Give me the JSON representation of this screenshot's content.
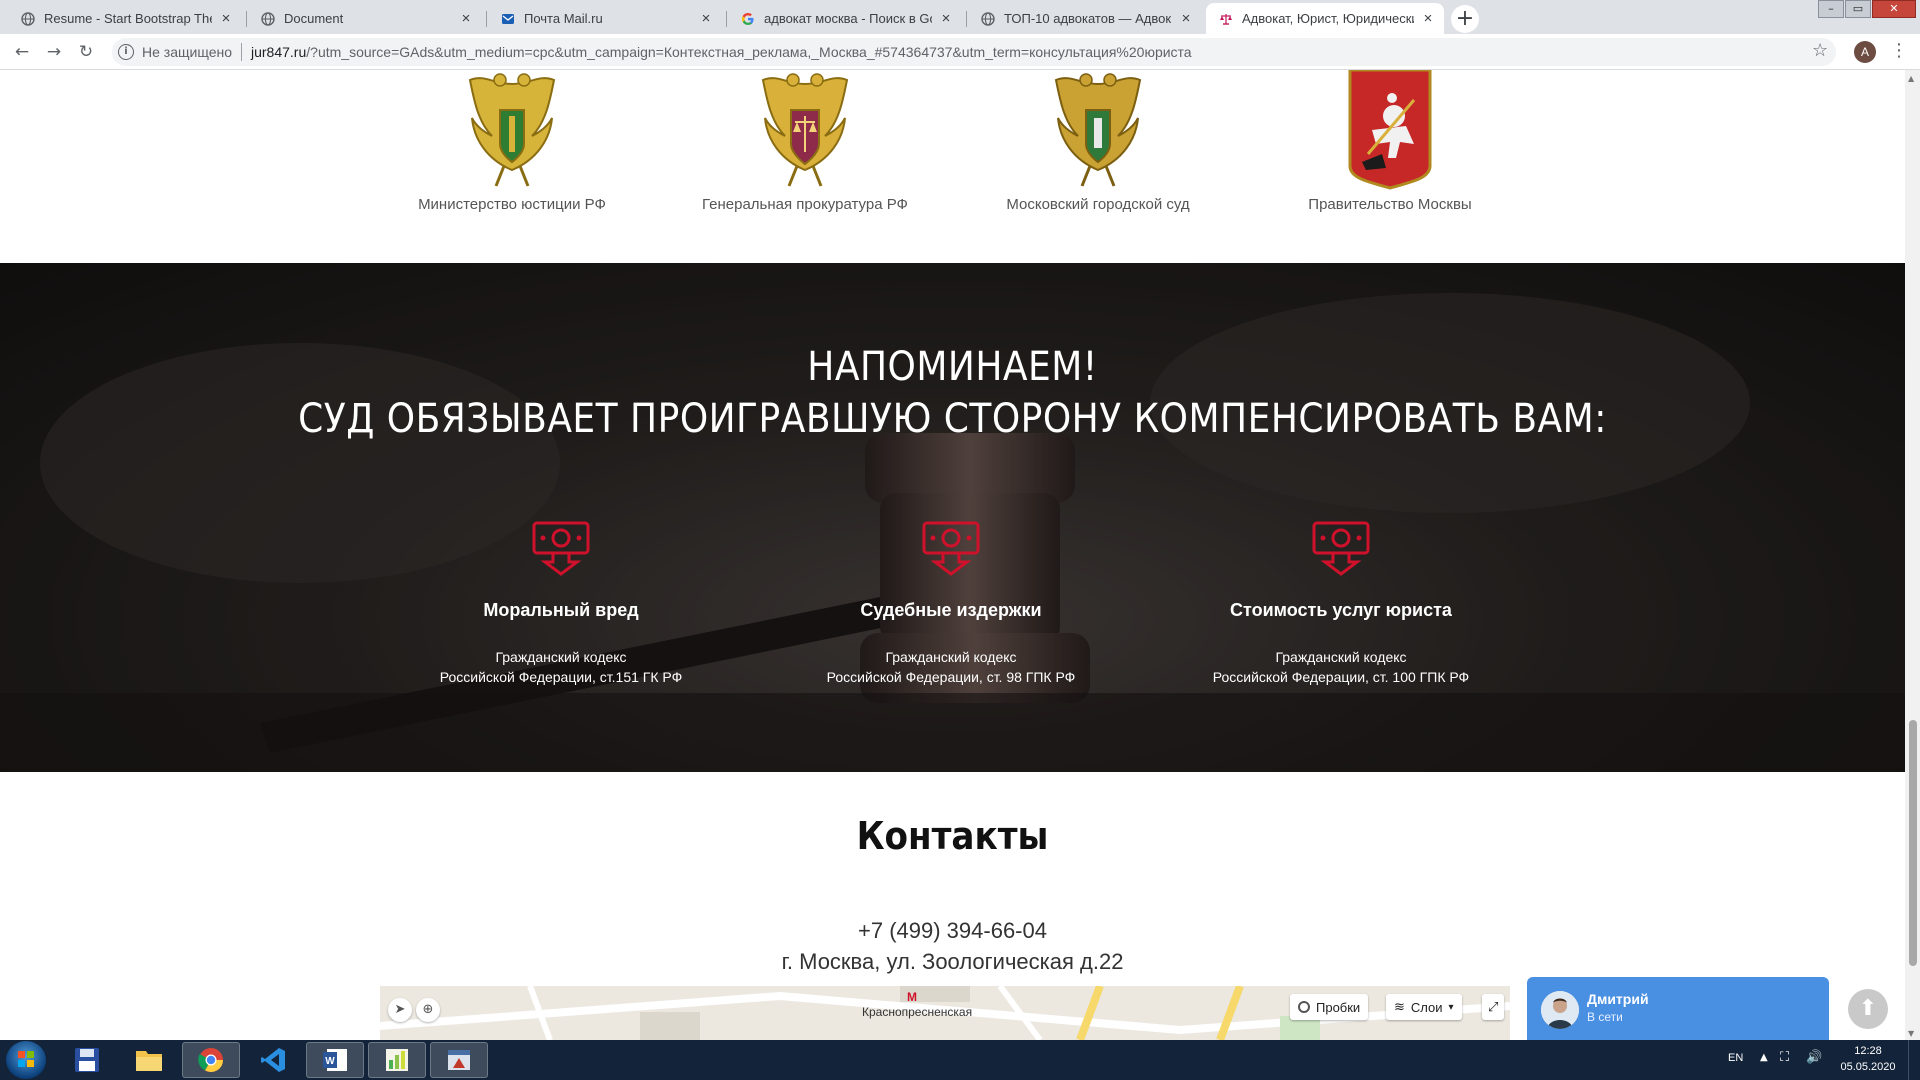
{
  "browser": {
    "tabs": [
      {
        "title": "Resume - Start Bootstrap Theme",
        "icon": "globe-icon",
        "active": false
      },
      {
        "title": "Document",
        "icon": "globe-icon",
        "active": false
      },
      {
        "title": "Почта Mail.ru",
        "icon": "mail-icon",
        "active": false
      },
      {
        "title": "адвокат москва - Поиск в Goog",
        "icon": "google-icon",
        "active": false
      },
      {
        "title": "ТОП-10 адвокатов — Адвокат К",
        "icon": "globe-icon",
        "active": false
      },
      {
        "title": "Адвокат, Юрист, Юридические",
        "icon": "scales-icon",
        "active": true
      }
    ],
    "security_label": "Не защищено",
    "url_host": "jur847.ru",
    "url_rest": "/?utm_source=GAds&utm_medium=cpc&utm_campaign=Контекстная_реклама,_Москва_#574364737&utm_term=консультация%20юриста",
    "profile_initial": "A"
  },
  "emblems": [
    {
      "caption": "Министерство юстиции РФ",
      "icon": "eagle-emblem-icon"
    },
    {
      "caption": "Генеральная прокуратура РФ",
      "icon": "eagle-scales-emblem-icon"
    },
    {
      "caption": "Московский городской суд",
      "icon": "eagle-shield-emblem-icon"
    },
    {
      "caption": "Правительство Москвы",
      "icon": "moscow-coat-of-arms-icon"
    }
  ],
  "hero": {
    "title_line1": "НАПОМИНАЕМ!",
    "title_line2": "СУД ОБЯЗЫВАЕТ ПРОИГРАВШУЮ СТОРОНУ КОМПЕНСИРОВАТЬ ВАМ:",
    "accent_color": "#d0112b",
    "features": [
      {
        "title": "Моральный вред",
        "line1": "Гражданский кодекс",
        "line2": "Российской Федерации, ст.151 ГК РФ",
        "icon": "money-down-icon"
      },
      {
        "title": "Судебные издержки",
        "line1": "Гражданский кодекс",
        "line2": "Российской Федерации, ст. 98 ГПК РФ",
        "icon": "money-down-icon"
      },
      {
        "title": "Стоимость услуг юриста",
        "line1": "Гражданский кодекс",
        "line2": "Российской Федерации, ст. 100 ГПК РФ",
        "icon": "money-down-icon"
      }
    ]
  },
  "contacts": {
    "title": "Контакты",
    "phone": "+7 (499) 394-66-04",
    "address": "г. Москва, ул. Зоологическая д.22"
  },
  "map": {
    "metro_label": "Краснопресненская",
    "traffic_label": "Пробки",
    "layers_label": "Слои"
  },
  "chat": {
    "name": "Дмитрий",
    "status": "В сети",
    "color": "#4a90e2"
  },
  "taskbar": {
    "lang": "EN",
    "time": "12:28",
    "date": "05.05.2020"
  }
}
